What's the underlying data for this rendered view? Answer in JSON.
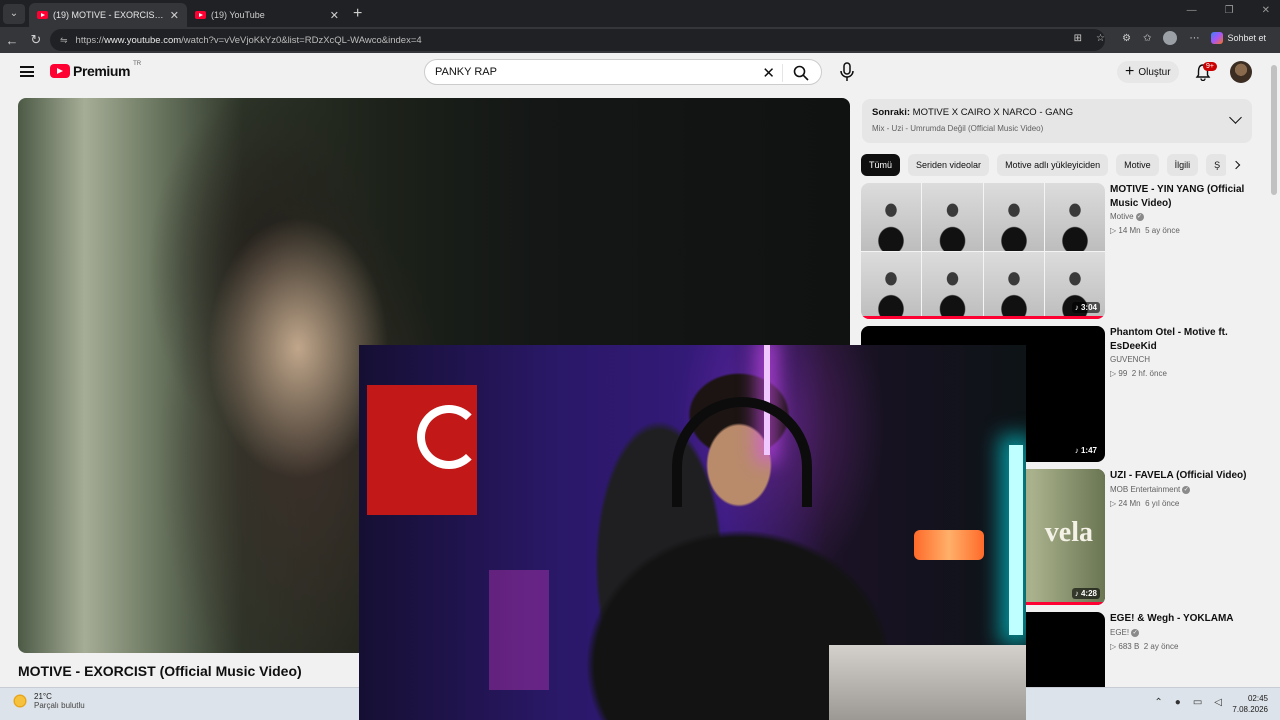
{
  "browser": {
    "tabs": [
      {
        "title": "(19) MOTIVE - EXORCIST (Official M",
        "active": true
      },
      {
        "title": "(19) YouTube",
        "active": false
      }
    ],
    "url_prefix": "https://",
    "url_host": "www.youtube.com",
    "url_path": "/watch?v=vVeVjoKkYz0&list=RDzXcQL-WAwco&index=4",
    "chat_label": "Sohbet et"
  },
  "masthead": {
    "logo_text": "Premium",
    "logo_country": "TR",
    "search_value": "PANKY RAP",
    "create_label": "Oluştur",
    "notif_badge": "9+"
  },
  "video": {
    "title": "MOTIVE - EXORCIST (Official Music Video)"
  },
  "up_next": {
    "label": "Sonraki:",
    "next_title": "MOTIVE X CAIRO X NARCO - GANG",
    "mix_line": "Mix - Uzi - Umrumda Değil (Official Music Video)"
  },
  "chips": [
    "Tümü",
    "Seriden videolar",
    "Motive adlı yükleyiciden",
    "Motive",
    "İlgili",
    "Ş"
  ],
  "recommendations": [
    {
      "title": "MOTIVE - YIN YANG (Official Music Video)",
      "channel": "Motive",
      "verified": true,
      "views": "14 Mn",
      "age": "5 ay önce",
      "duration": "3:04",
      "thumb": "grid"
    },
    {
      "title": "Phantom Otel - Motive ft. EsDeeKid",
      "channel": "GUVENCH",
      "verified": false,
      "views": "99",
      "age": "2 hf. önce",
      "duration": "1:47",
      "thumb": "dark"
    },
    {
      "title": "UZI - FAVELA (Official Video)",
      "channel": "MOB Entertainment",
      "verified": true,
      "views": "24 Mn",
      "age": "6 yıl önce",
      "duration": "4:28",
      "thumb": "favela",
      "thumb_text": "vela"
    },
    {
      "title": "EGE! & Wegh - YOKLAMA",
      "channel": "EGE!",
      "verified": true,
      "views": "683 B",
      "age": "2 ay önce",
      "duration": "",
      "thumb": "dark"
    }
  ],
  "taskbar": {
    "temp": "21°C",
    "condition": "Parçalı bulutlu",
    "time": "02:45",
    "date": "7.08.2026"
  },
  "icons": {
    "views_glyph": "▷",
    "music_glyph": "♪",
    "close_glyph": "✕",
    "plus_glyph": "+",
    "lock_glyph": "⇋",
    "verified_glyph": "✓"
  },
  "colors": {
    "youtube_red": "#ff0033",
    "chip_active_bg": "#0f0f0f",
    "browser_dark": "#202124"
  }
}
